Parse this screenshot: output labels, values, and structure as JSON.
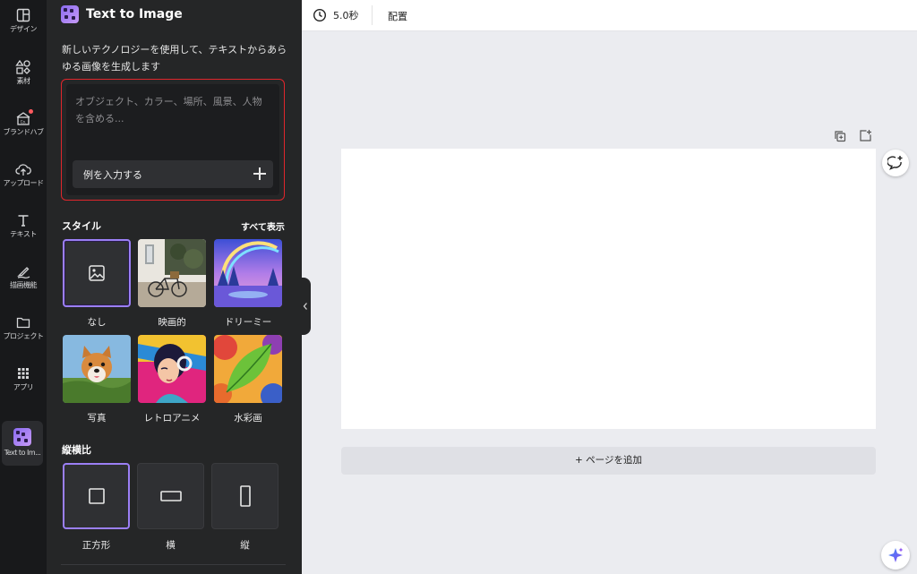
{
  "rail": {
    "items": [
      {
        "label": "デザイン",
        "icon": "layout-icon"
      },
      {
        "label": "素材",
        "icon": "shapes-icon"
      },
      {
        "label": "ブランドハブ",
        "icon": "brand-hub-icon"
      },
      {
        "label": "アップロード",
        "icon": "upload-cloud-icon"
      },
      {
        "label": "テキスト",
        "icon": "text-icon"
      },
      {
        "label": "描画機能",
        "icon": "draw-icon"
      },
      {
        "label": "プロジェクト",
        "icon": "folder-icon"
      },
      {
        "label": "アプリ",
        "icon": "apps-grid-icon"
      },
      {
        "label": "Text to Im...",
        "icon": "text-to-image-app-icon"
      }
    ]
  },
  "panel": {
    "title": "Text to Image",
    "description": "新しいテクノロジーを使用して、テキストからあらゆる画像を生成します",
    "prompt": {
      "placeholder": "オブジェクト、カラー、場所、風景、人物を含める...",
      "example_button": "例を入力する"
    },
    "style_section": {
      "heading": "スタイル",
      "see_all": "すべて表示",
      "styles": [
        {
          "label": "なし",
          "selected": true
        },
        {
          "label": "映画的",
          "selected": false
        },
        {
          "label": "ドリーミー",
          "selected": false
        },
        {
          "label": "写真",
          "selected": false
        },
        {
          "label": "レトロアニメ",
          "selected": false
        },
        {
          "label": "水彩画",
          "selected": false
        }
      ]
    },
    "aspect_section": {
      "heading": "縦横比",
      "options": [
        {
          "label": "正方形",
          "selected": true
        },
        {
          "label": "横",
          "selected": false
        },
        {
          "label": "縦",
          "selected": false
        }
      ]
    }
  },
  "topbar": {
    "duration": "5.0秒",
    "arrange": "配置"
  },
  "canvas": {
    "add_page": "+ ページを追加"
  },
  "colors": {
    "accent": "#9b7ff5",
    "prompt_border": "#e0262c",
    "panel_bg": "#252627",
    "rail_bg": "#18191b"
  }
}
